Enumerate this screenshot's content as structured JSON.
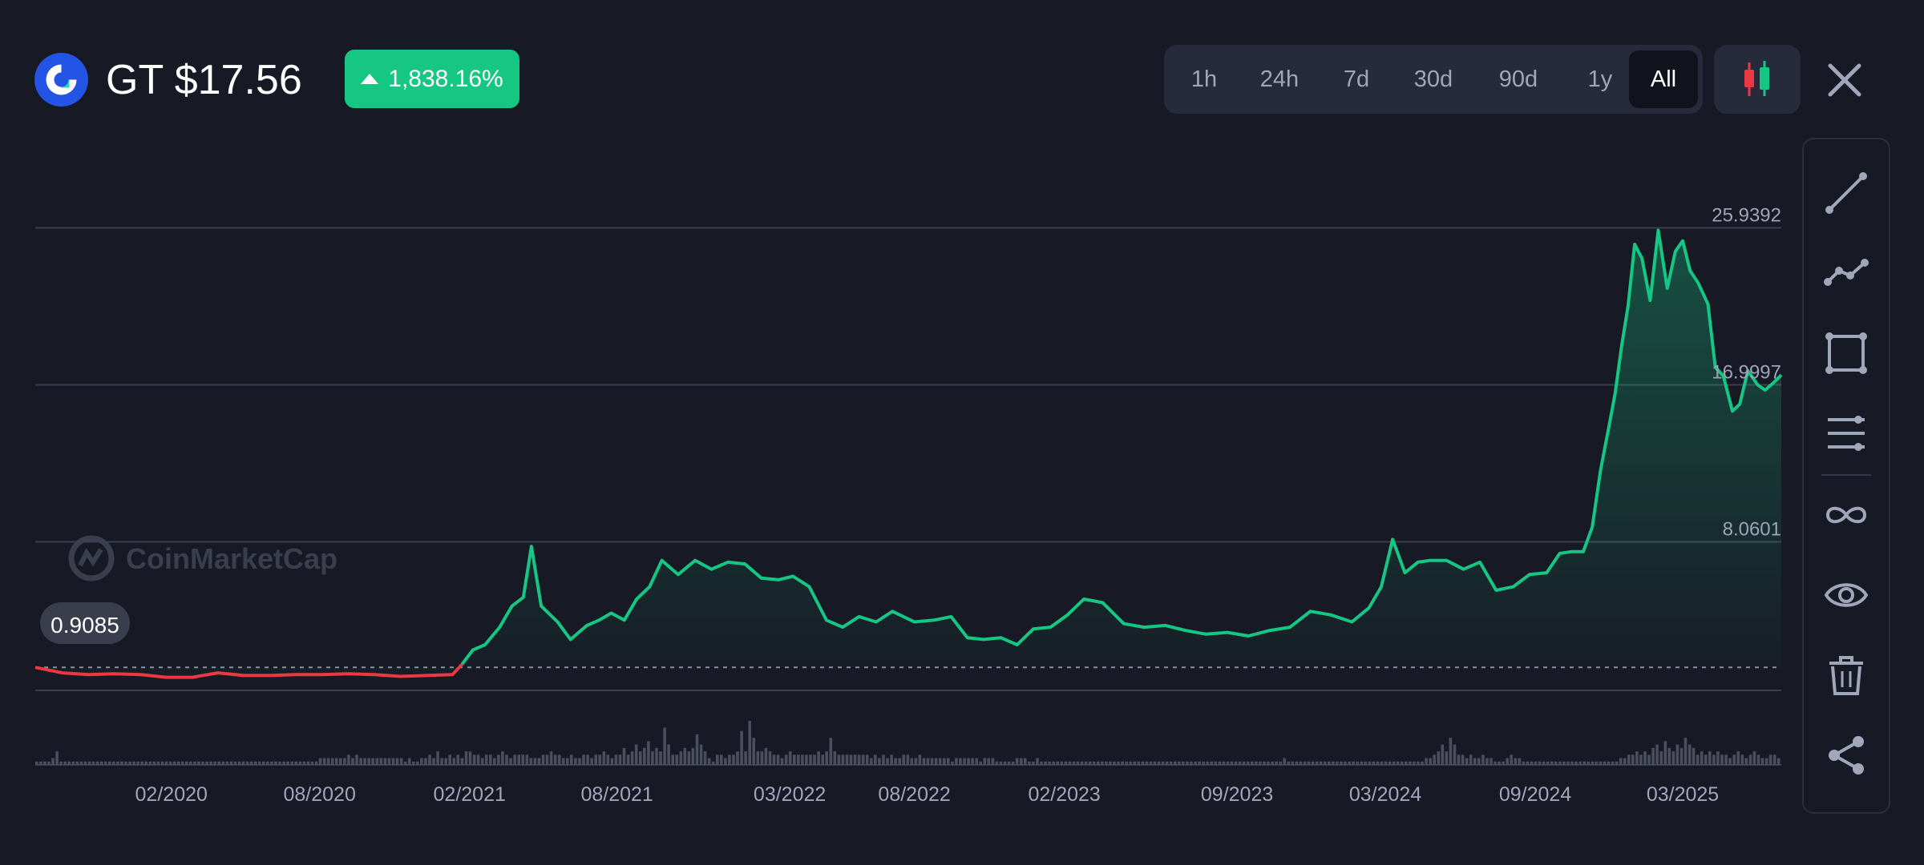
{
  "header": {
    "symbol": "GT",
    "price": "$17.56",
    "title": "GT $17.56",
    "change": "1,838.16%",
    "change_direction": "up",
    "logo_icon": "gatetoken-logo-icon"
  },
  "range_tabs": [
    {
      "label": "1h",
      "active": false
    },
    {
      "label": "24h",
      "active": false
    },
    {
      "label": "7d",
      "active": false
    },
    {
      "label": "30d",
      "active": false
    },
    {
      "label": "90d",
      "active": false
    },
    {
      "label": "1y",
      "active": false
    },
    {
      "label": "All",
      "active": true
    }
  ],
  "controls": {
    "candlestick_icon": "candlestick-icon",
    "close_icon": "close-icon"
  },
  "toolbar": [
    "trend-line-icon",
    "polyline-icon",
    "rectangle-icon",
    "horizontal-lines-icon",
    "infinity-icon",
    "eye-icon",
    "trash-icon",
    "share-icon"
  ],
  "watermark": "CoinMarketCap",
  "colors": {
    "background": "#171924",
    "up": "#16c784",
    "down": "#ea3943",
    "grid": "#3a3e4e",
    "volume": "#4a4e5e"
  },
  "chart_data": {
    "type": "area",
    "yticks": [
      "25.9392",
      "16.9997",
      "8.0601"
    ],
    "start_value_label": "0.9085",
    "baseline": 0.9085,
    "ylim": [
      -0.4,
      28.65
    ],
    "x_tick_labels": [
      "02/2020",
      "08/2020",
      "02/2021",
      "08/2021",
      "03/2022",
      "08/2022",
      "02/2023",
      "09/2023",
      "03/2024",
      "09/2024",
      "03/2025"
    ],
    "x_tick_dates": [
      "2020-02",
      "2020-08",
      "2021-02",
      "2021-08",
      "2022-03",
      "2022-08",
      "2023-02",
      "2023-09",
      "2024-03",
      "2024-09",
      "2025-03"
    ],
    "series": [
      {
        "dates": [
          "2019-08-18",
          "2019-09-20",
          "2019-10-22",
          "2019-11-23",
          "2019-12-25",
          "2020-01-26",
          "2020-02-27",
          "2020-03-29",
          "2020-04-30",
          "2020-06-01",
          "2020-07-03",
          "2020-08-04",
          "2020-09-05",
          "2020-10-07",
          "2020-11-08",
          "2020-12-10",
          "2021-01-11",
          "2021-01-23",
          "2021-02-05",
          "2021-02-20",
          "2021-03-10",
          "2021-03-25",
          "2021-04-08",
          "2021-04-18",
          "2021-04-30",
          "2021-05-20",
          "2021-06-05",
          "2021-06-25",
          "2021-07-10",
          "2021-07-25",
          "2021-08-10",
          "2021-08-25",
          "2021-09-10",
          "2021-09-25",
          "2021-10-15",
          "2021-11-05",
          "2021-11-25",
          "2021-12-15",
          "2022-01-05",
          "2022-01-25",
          "2022-02-15",
          "2022-03-05",
          "2022-03-25",
          "2022-04-15",
          "2022-05-05",
          "2022-05-25",
          "2022-06-15",
          "2022-07-05",
          "2022-08-01",
          "2022-08-25",
          "2022-09-15",
          "2022-10-05",
          "2022-10-25",
          "2022-11-15",
          "2022-12-05",
          "2022-12-25",
          "2023-01-15",
          "2023-02-05",
          "2023-02-25",
          "2023-03-20",
          "2023-04-15",
          "2023-05-10",
          "2023-06-05",
          "2023-07-01",
          "2023-07-25",
          "2023-08-20",
          "2023-09-15",
          "2023-10-10",
          "2023-11-05",
          "2023-11-30",
          "2023-12-25",
          "2024-01-20",
          "2024-02-10",
          "2024-02-25",
          "2024-03-10",
          "2024-03-25",
          "2024-04-10",
          "2024-04-25",
          "2024-05-15",
          "2024-06-05",
          "2024-06-25",
          "2024-07-15",
          "2024-08-05",
          "2024-08-25",
          "2024-09-15",
          "2024-10-01",
          "2024-10-15",
          "2024-10-30",
          "2024-11-10",
          "2024-11-20",
          "2024-11-30",
          "2024-12-08",
          "2024-12-16",
          "2024-12-24",
          "2025-01-01",
          "2025-01-10",
          "2025-01-20",
          "2025-01-30",
          "2025-02-10",
          "2025-02-20",
          "2025-03-01",
          "2025-03-10",
          "2025-03-20",
          "2025-04-01",
          "2025-04-10",
          "2025-04-20",
          "2025-05-01",
          "2025-05-10",
          "2025-05-20",
          "2025-06-01",
          "2025-06-10",
          "2025-06-20",
          "2025-06-30"
        ],
        "values": [
          0.9085,
          0.6,
          0.5,
          0.55,
          0.5,
          0.35,
          0.35,
          0.6,
          0.45,
          0.45,
          0.5,
          0.5,
          0.55,
          0.5,
          0.4,
          0.45,
          0.5,
          1.1,
          1.9,
          2.2,
          3.2,
          4.4,
          4.9,
          7.8,
          4.4,
          3.5,
          2.5,
          3.3,
          3.6,
          4.0,
          3.6,
          4.8,
          5.5,
          7.0,
          6.2,
          7.0,
          6.5,
          6.9,
          6.8,
          6.0,
          5.9,
          6.1,
          5.5,
          3.6,
          3.2,
          3.8,
          3.5,
          4.1,
          3.5,
          3.6,
          3.8,
          2.6,
          2.5,
          2.6,
          2.2,
          3.1,
          3.2,
          3.9,
          4.8,
          4.6,
          3.4,
          3.2,
          3.3,
          3.0,
          2.8,
          2.9,
          2.7,
          3.0,
          3.2,
          4.1,
          3.9,
          3.5,
          4.3,
          5.5,
          8.2,
          6.3,
          6.9,
          7.0,
          7.0,
          6.5,
          6.9,
          5.3,
          5.5,
          6.2,
          6.3,
          7.4,
          7.5,
          7.5,
          8.9,
          12.1,
          14.5,
          16.5,
          19.2,
          21.5,
          25.0,
          24.2,
          21.8,
          25.8,
          22.5,
          24.6,
          25.2,
          23.5,
          22.8,
          21.6,
          18.0,
          17.5,
          15.5,
          15.9,
          17.8,
          17.0,
          16.7,
          17.1,
          17.56
        ]
      }
    ],
    "volume_bars": [
      1,
      1,
      1,
      1,
      2,
      4,
      1,
      1,
      1,
      1,
      1,
      1,
      1,
      1,
      1,
      1,
      1,
      1,
      1,
      1,
      1,
      1,
      1,
      1,
      1,
      1,
      1,
      1,
      1,
      1,
      1,
      1,
      1,
      1,
      1,
      1,
      1,
      1,
      1,
      1,
      1,
      1,
      1,
      1,
      1,
      1,
      1,
      1,
      1,
      1,
      1,
      1,
      1,
      1,
      1,
      1,
      1,
      1,
      1,
      1,
      1,
      1,
      1,
      1,
      1,
      1,
      1,
      1,
      1,
      1,
      2,
      2,
      2,
      2,
      2,
      2,
      2,
      3,
      2,
      3,
      2,
      2,
      2,
      2,
      2,
      2,
      2,
      2,
      2,
      2,
      2,
      1,
      2,
      1,
      1,
      2,
      2,
      3,
      2,
      4,
      2,
      2,
      3,
      2,
      3,
      2,
      4,
      4,
      3,
      3,
      2,
      3,
      3,
      2,
      3,
      4,
      3,
      2,
      3,
      3,
      3,
      3,
      2,
      2,
      2,
      3,
      3,
      4,
      3,
      3,
      2,
      2,
      3,
      2,
      2,
      3,
      3,
      2,
      3,
      3,
      4,
      3,
      2,
      3,
      3,
      5,
      3,
      4,
      6,
      4,
      5,
      7,
      4,
      5,
      4,
      11,
      6,
      3,
      3,
      4,
      5,
      4,
      5,
      9,
      6,
      4,
      2,
      1,
      3,
      3,
      2,
      3,
      3,
      4,
      10,
      4,
      13,
      8,
      4,
      4,
      5,
      4,
      3,
      3,
      2,
      3,
      4,
      3,
      3,
      3,
      3,
      3,
      3,
      4,
      3,
      4,
      8,
      4,
      3,
      3,
      3,
      3,
      3,
      3,
      3,
      3,
      2,
      3,
      2,
      3,
      2,
      3,
      2,
      2,
      3,
      3,
      2,
      2,
      3,
      2,
      2,
      2,
      2,
      2,
      2,
      2,
      1,
      2,
      2,
      2,
      2,
      2,
      2,
      1,
      2,
      2,
      2,
      1,
      1,
      1,
      1,
      1,
      2,
      2,
      2,
      1,
      1,
      2,
      1,
      1,
      1,
      1,
      1,
      1,
      1,
      1,
      1,
      1,
      1,
      1,
      1,
      1,
      1,
      1,
      1,
      1,
      1,
      1,
      1,
      1,
      1,
      1,
      1,
      1,
      1,
      1,
      1,
      1,
      1,
      1,
      1,
      1,
      1,
      1,
      1,
      1,
      1,
      1,
      1,
      1,
      1,
      1,
      1,
      1,
      1,
      1,
      1,
      1,
      1,
      1,
      1,
      1,
      1,
      1,
      1,
      1,
      1,
      1,
      2,
      1,
      1,
      1,
      1,
      1,
      1,
      1,
      1,
      1,
      1,
      1,
      1,
      1,
      1,
      1,
      1,
      1,
      1,
      1,
      1,
      1,
      1,
      1,
      1,
      1,
      1,
      1,
      1,
      1,
      1,
      1,
      1,
      1,
      1,
      2,
      2,
      3,
      4,
      6,
      4,
      8,
      6,
      3,
      3,
      2,
      3,
      2,
      2,
      3,
      2,
      2,
      1,
      1,
      1,
      2,
      3,
      2,
      2,
      1,
      1,
      1,
      1,
      1,
      1,
      1,
      1,
      1,
      1,
      1,
      1,
      1,
      1,
      1,
      1,
      1,
      1,
      1,
      1,
      1,
      1,
      1,
      1,
      2,
      2,
      3,
      3,
      4,
      3,
      4,
      3,
      5,
      6,
      4,
      7,
      5,
      4,
      6,
      5,
      8,
      6,
      5,
      3,
      4,
      3,
      4,
      3,
      4,
      3,
      3,
      2,
      3,
      4,
      3,
      2,
      3,
      4,
      3,
      2,
      2,
      3,
      3,
      2
    ]
  }
}
